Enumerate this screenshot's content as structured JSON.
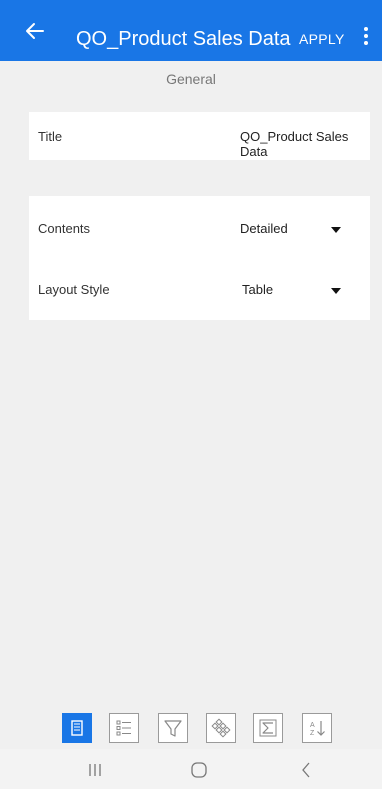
{
  "header": {
    "title": "QO_Product Sales Data",
    "apply_label": "APPLY",
    "back_icon": "arrow-left-icon",
    "more_icon": "more-vertical-icon"
  },
  "section": {
    "label": "General"
  },
  "title_row": {
    "label": "Title",
    "value": "QO_Product Sales Data"
  },
  "contents_row": {
    "label": "Contents",
    "value": "Detailed"
  },
  "layout_row": {
    "label": "Layout Style",
    "value": "Table"
  },
  "toolbar": {
    "items": [
      {
        "icon": "general-icon",
        "active": true
      },
      {
        "icon": "list-icon",
        "active": false
      },
      {
        "icon": "filter-icon",
        "active": false
      },
      {
        "icon": "pattern-icon",
        "active": false
      },
      {
        "icon": "sum-icon",
        "active": false
      },
      {
        "icon": "sort-az-icon",
        "active": false
      }
    ]
  },
  "colors": {
    "primary": "#1976e6",
    "background": "#f0f0f0"
  },
  "system_nav": {
    "recent_icon": "recents-icon",
    "home_icon": "home-icon",
    "back_icon": "back-chevron-icon"
  }
}
